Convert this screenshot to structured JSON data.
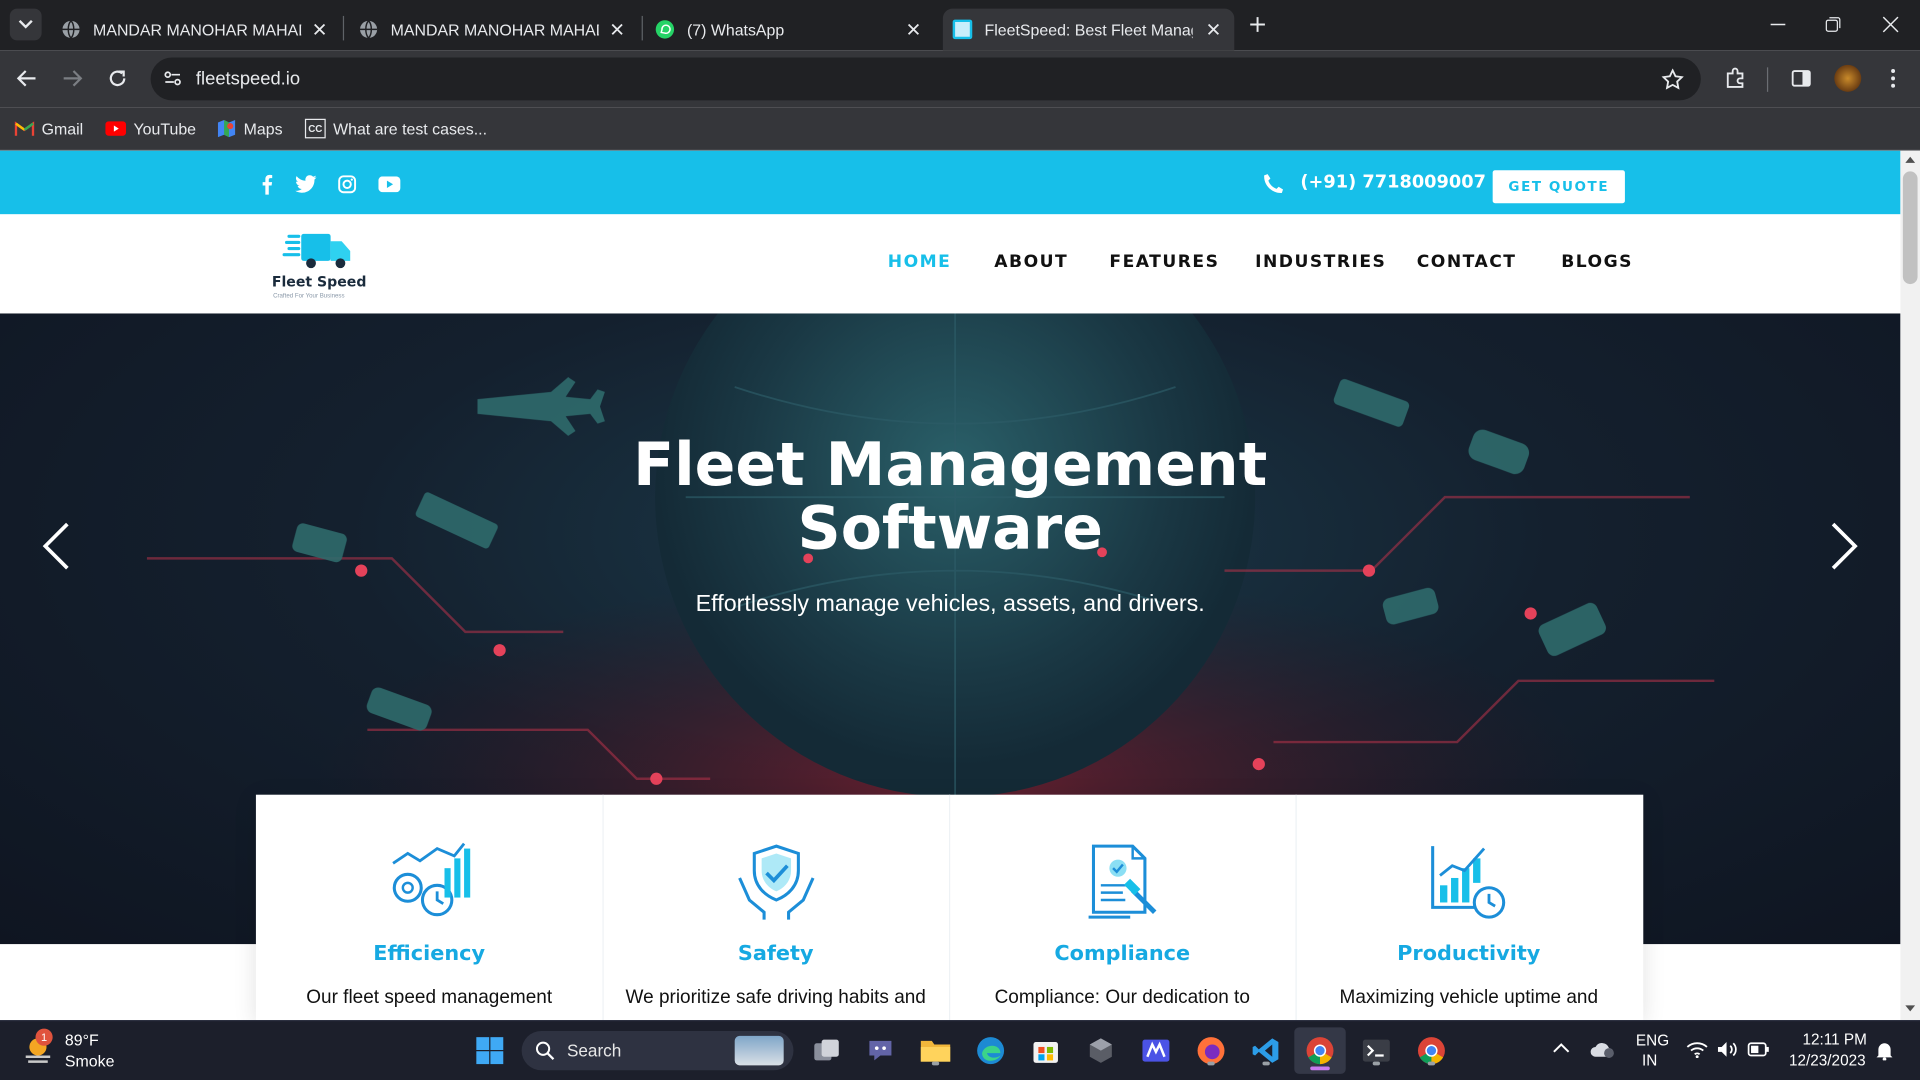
{
  "browser": {
    "tabs": [
      {
        "title": "MANDAR MANOHAR MAHADIK",
        "icon": "globe-icon"
      },
      {
        "title": "MANDAR MANOHAR MAHADIK",
        "icon": "globe-icon"
      },
      {
        "title": "(7) WhatsApp",
        "icon": "whatsapp-icon"
      },
      {
        "title": "FleetSpeed: Best Fleet Management",
        "icon": "fleetspeed-favicon",
        "active": true
      }
    ],
    "url": "fleetspeed.io",
    "bookmarks": [
      {
        "label": "Gmail",
        "icon": "gmail-icon"
      },
      {
        "label": "YouTube",
        "icon": "youtube-icon"
      },
      {
        "label": "Maps",
        "icon": "maps-icon"
      },
      {
        "label": "What are test cases...",
        "icon": "cc-icon"
      }
    ]
  },
  "site": {
    "phone": "(+91) 7718009007",
    "quote_button": "GET QUOTE",
    "logo_name": "Fleet Speed",
    "logo_tagline": "Crafted For Your Business",
    "nav": [
      "HOME",
      "ABOUT",
      "FEATURES",
      "INDUSTRIES",
      "CONTACT",
      "BLOGS"
    ],
    "nav_active": "HOME",
    "hero": {
      "title": "Fleet Management Software",
      "subtitle": "Effortlessly manage vehicles, assets, and drivers."
    },
    "cards": [
      {
        "title": "Efficiency",
        "text": "Our fleet speed management",
        "icon": "efficiency-icon"
      },
      {
        "title": "Safety",
        "text": "We prioritize safe driving habits and",
        "icon": "safety-icon"
      },
      {
        "title": "Compliance",
        "text": "Compliance: Our dedication to",
        "icon": "compliance-icon"
      },
      {
        "title": "Productivity",
        "text": "Maximizing vehicle uptime and",
        "icon": "productivity-icon"
      }
    ],
    "colors": {
      "accent": "#17bfe9",
      "card_title": "#16a9e2",
      "hero_bg": "#14202e"
    }
  },
  "taskbar": {
    "weather": {
      "temp": "89°F",
      "condition": "Smoke",
      "badge": "1"
    },
    "search_placeholder": "Search",
    "lang": {
      "line1": "ENG",
      "line2": "IN"
    },
    "time": "12:11 PM",
    "date": "12/23/2023"
  }
}
